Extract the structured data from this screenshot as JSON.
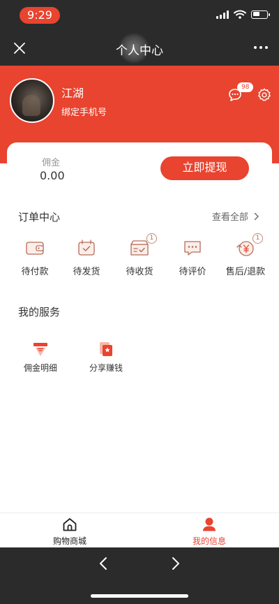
{
  "status": {
    "time": "9:29"
  },
  "nav": {
    "title": "个人中心"
  },
  "profile": {
    "nickname": "江湖",
    "bind_phone": "绑定手机号",
    "message_count": "98"
  },
  "commission": {
    "label": "佣金",
    "value": "0.00",
    "withdraw_label": "立即提现"
  },
  "orders": {
    "title": "订单中心",
    "view_all": "查看全部",
    "items": [
      {
        "label": "待付款",
        "icon": "wallet-icon"
      },
      {
        "label": "待发货",
        "icon": "calendar-check-icon"
      },
      {
        "label": "待收货",
        "icon": "package-check-icon",
        "badge": "1"
      },
      {
        "label": "待评价",
        "icon": "comment-dots-icon"
      },
      {
        "label": "售后/退款",
        "icon": "yen-refund-icon",
        "badge": "1"
      }
    ]
  },
  "services": {
    "title": "我的服务",
    "items": [
      {
        "label": "佣金明细",
        "icon": "commission-detail-icon"
      },
      {
        "label": "分享赚钱",
        "icon": "share-earn-icon"
      }
    ]
  },
  "tabbar": {
    "items": [
      {
        "label": "购物商城",
        "icon": "home-icon",
        "active": false
      },
      {
        "label": "我的信息",
        "icon": "user-icon",
        "active": true
      }
    ]
  },
  "colors": {
    "accent": "#e8442f",
    "dark_bar": "#2b2b2b",
    "icon_line": "#b76b5a"
  }
}
